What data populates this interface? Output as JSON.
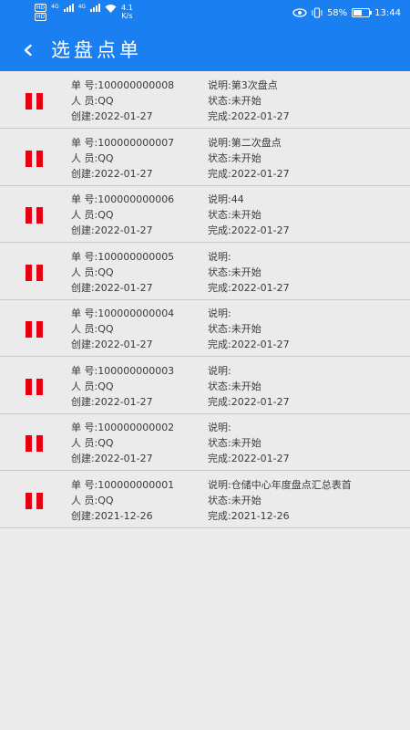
{
  "status_bar": {
    "hd1": "HD",
    "hd2": "HD",
    "net1": "4G",
    "net2": "4G",
    "speed_value": "4.1",
    "speed_unit": "K/s",
    "battery_percent": "58%",
    "battery_level": 0.58,
    "time": "13:44"
  },
  "header": {
    "title": "选盘点单"
  },
  "labels": {
    "number": "单 号:",
    "person": "人 员:",
    "created": "创建:",
    "desc": "说明:",
    "status": "状态:",
    "completed": "完成:"
  },
  "orders": [
    {
      "number": "100000000008",
      "person": "QQ",
      "created": "2022-01-27",
      "desc": "第3次盘点",
      "status": "未开始",
      "completed": "2022-01-27"
    },
    {
      "number": "100000000007",
      "person": "QQ",
      "created": "2022-01-27",
      "desc": "第二次盘点",
      "status": "未开始",
      "completed": "2022-01-27"
    },
    {
      "number": "100000000006",
      "person": "QQ",
      "created": "2022-01-27",
      "desc": "44",
      "status": "未开始",
      "completed": "2022-01-27"
    },
    {
      "number": "100000000005",
      "person": "QQ",
      "created": "2022-01-27",
      "desc": "",
      "status": "未开始",
      "completed": "2022-01-27"
    },
    {
      "number": "100000000004",
      "person": "QQ",
      "created": "2022-01-27",
      "desc": "",
      "status": "未开始",
      "completed": "2022-01-27"
    },
    {
      "number": "100000000003",
      "person": "QQ",
      "created": "2022-01-27",
      "desc": "",
      "status": "未开始",
      "completed": "2022-01-27"
    },
    {
      "number": "100000000002",
      "person": "QQ",
      "created": "2022-01-27",
      "desc": "",
      "status": "未开始",
      "completed": "2022-01-27"
    },
    {
      "number": "100000000001",
      "person": "QQ",
      "created": "2021-12-26",
      "desc": "仓储中心年度盘点汇总表首",
      "status": "未开始",
      "completed": "2021-12-26"
    }
  ],
  "colors": {
    "accent": "#1a7ff0",
    "pause_icon": "#e60012",
    "background": "#ebebeb"
  }
}
